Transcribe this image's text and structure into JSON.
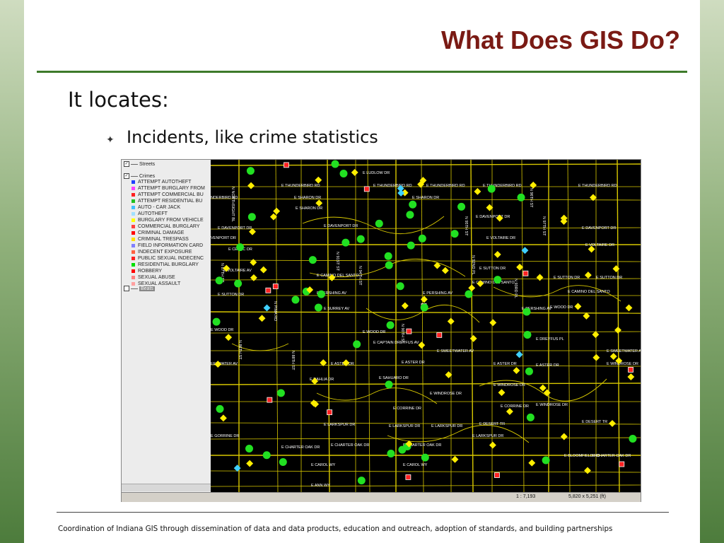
{
  "slide": {
    "title": "What Does GIS Do?",
    "heading": "It locates:",
    "bullet_glyph": "✦",
    "bullet_text": "Incidents, like crime statistics",
    "footer": "Coordination of Indiana GIS through dissemination of data and data products, education and outreach, adoption of standards, and building partnerships"
  },
  "legend": {
    "streets_group": "Streets",
    "crimes_group": "Crimes",
    "beats_group": "Beats",
    "checkbox_mark": "✓",
    "items": [
      {
        "label": "ATTEMPT AUTOTHEFT",
        "color": "#2040ff"
      },
      {
        "label": "ATTEMPT BURGLARY FROM",
        "color": "#ff40ff"
      },
      {
        "label": "ATTEMPT COMMERCIAL BU",
        "color": "#ff2020"
      },
      {
        "label": "ATTEMPT RESIDENTIAL BU",
        "color": "#20c020"
      },
      {
        "label": "AUTO - CAR JACK",
        "color": "#40c0ff"
      },
      {
        "label": "AUTOTHEFT",
        "color": "#a0e0ff"
      },
      {
        "label": "BURGLARY FROM VEHICLE",
        "color": "#ffff00"
      },
      {
        "label": "COMMERCIAL BURGLARY",
        "color": "#ff4040"
      },
      {
        "label": "CRIMINAL DAMAGE",
        "color": "#ff0000"
      },
      {
        "label": "CRIMINAL TRESPASS",
        "color": "#ffe000"
      },
      {
        "label": "FIELD INFORMATION CARD",
        "color": "#8080ff"
      },
      {
        "label": "INDECENT EXPOSURE",
        "color": "#ff6040"
      },
      {
        "label": "PUBLIC SEXUAL INDECENC",
        "color": "#ff2020"
      },
      {
        "label": "RESIDENTIAL BURGLARY",
        "color": "#00e000"
      },
      {
        "label": "ROBBERY",
        "color": "#ff0000"
      },
      {
        "label": "SEXUAL ABUSE",
        "color": "#ff8080"
      },
      {
        "label": "SEXUAL ASSAULT",
        "color": "#ffa0a0"
      }
    ]
  },
  "status": {
    "scale": "1 : 7,193",
    "dimensions": "5,820 x 5,251 (ft)"
  },
  "map": {
    "street_color": "#d8c800",
    "label_color": "#ffffff",
    "street_labels": [
      "E LUDLOW DR",
      "N NORTHSIGHT BL",
      "E THUNDERBIRD RD",
      "E THUNDERBIRD RD",
      "E THUNDERBIRD RD",
      "E THUNDERBIRD RD",
      "E THUNDERBIRD RD",
      "NDERBIRD RD",
      "E SHARON DR",
      "E SHARON DR",
      "E SHARON DR",
      "E DAVENPORT DR",
      "E DAVENPORT DR",
      "E DAVENPORT DR",
      "E DAVENPORT DR",
      "VENPORT DR",
      "E VOLTAIRE DR",
      "E VOLTAIRE DR",
      "E VOLTAIRE AV",
      "E CELTIC DR",
      "N 87TH ST",
      "N 92ND PL",
      "E SUTTON DR",
      "E SUTTON DR",
      "E SUTTON DR",
      "E SUTTON DR",
      "E CAMINO DEL SANTO",
      "E CAMINO DEL SANTO",
      "E CAMINO DEL SANTO",
      "E PERSHING AV",
      "E PERSHING AV",
      "E PERSHING AV",
      "E SURREY AV",
      "E WOOD DR",
      "E WOOD DR",
      "E WOOD DR",
      "E CAPTAIN DREYFUS AV",
      "E DREYFUS PL",
      "E SWEETWATER AV",
      "E SWEETWATER AV",
      "EETWATER AV",
      "E ASTER DR",
      "E ASTER DR",
      "E ASTER DR",
      "E ASTER DR",
      "E WINDROSE DR",
      "E WINDROSE DR",
      "E WINDROSE DR",
      "E WINDROSE DR",
      "E DAHLIA DR",
      "E SAHUARO DR",
      "E CORRINE DR",
      "E CORRINE DR",
      "E GORRINE DR",
      "E LARKSPUR DR",
      "E LARKSPUR DR",
      "E LARKSPUR DR",
      "E LARKSPUR DR",
      "E CHARTER OAK DR",
      "E CHARTER OAK DR",
      "E CHARTER OAK DR",
      "E CHARTER OAK DR",
      "E CAROL WY",
      "E CAROL WY",
      "E ANN WY",
      "E BLOOMFIELD RD",
      "E DESERT TR",
      "E DESERT TR",
      "N 93RD PL",
      "N 94TH ST",
      "N 90TH ST",
      "N 91ST ST",
      "N 86TH ST",
      "N 88TH ST",
      "N 95TH ST",
      "N 96TH ST",
      "N 97TH ST",
      "N PIMA RD"
    ]
  }
}
